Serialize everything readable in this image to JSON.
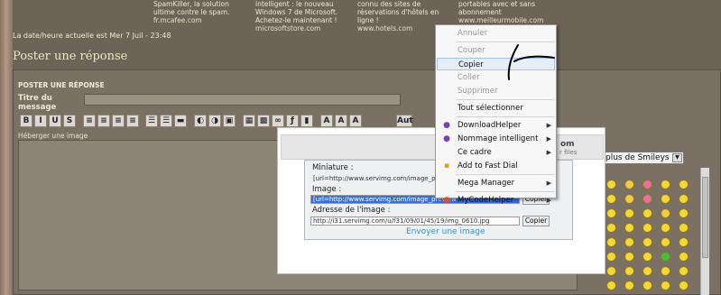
{
  "ads": [
    {
      "text": "SpamKiller, la solution ultime contre le spam.",
      "url": "fr.mcafee.com"
    },
    {
      "text": "intelligent : le nouveau Windows 7 de Microsoft. Achetez-le maintenant !",
      "url": "microsoftstore.com"
    },
    {
      "text": "connu des sites de réservations d'hôtels en ligne !",
      "url": "www.hotels.com"
    },
    {
      "text": "portables avec et sans abonnement",
      "url": "www.meilleurmobile.com"
    }
  ],
  "date_line": "La date/heure actuelle est Mer 7 Juil - 23:48",
  "page_title": "Poster une réponse",
  "form": {
    "heading": "POSTER UNE RÉPONSE",
    "title_label": "Titre du message",
    "host_label": "Héberger une image",
    "toolbar": [
      "B",
      "I",
      "U",
      "S",
      "≡",
      "≡",
      "≡",
      "≡",
      "☰",
      "☰",
      "▬",
      "◐",
      "◑",
      "▣",
      "▦",
      "▩",
      "∞",
      "ƒ",
      "▮",
      "A",
      "A",
      "A",
      "Aut"
    ]
  },
  "smileys": {
    "select_label": "plus de Smileys",
    "colors": [
      "#f6d63a",
      "#f3c84a",
      "#e96f9c",
      "#f6d63a",
      "#f6d63a",
      "#f6d63a",
      "#f3c84a",
      "#e96f9c",
      "#f6d63a",
      "#f6d63a",
      "#f6d63a",
      "#f6d63a",
      "#f6d63a",
      "#f3c84a",
      "#f6d63a",
      "#f6d63a",
      "#f6d63a",
      "#f6d63a",
      "#f6d63a",
      "#f6d63a",
      "#f6d63a",
      "#f6d63a",
      "#f6d63a",
      "#f6d63a",
      "#f6d63a",
      "#f6d63a",
      "#f6d63a",
      "#f6d63a",
      "#3fbf3f",
      "#f6d63a",
      "#f6d63a",
      "#f6d63a",
      "#f6d63a",
      "#f6d63a",
      "#f6d63a",
      "#f6d63a",
      "#f6d63a",
      "#f6d63a",
      "#f6d63a",
      "#f6d63a"
    ]
  },
  "servimg": {
    "brand": "om",
    "brand_sub": "r files",
    "miniature_label": "Miniature :",
    "miniature_value": "[url=http://www.servimg.com/image_previ",
    "image_label": "Image :",
    "image_value": "[url=http://www.servimg.com/image_preview",
    "address_label": "Adresse de l'image :",
    "address_value": "http://i31.servimg.com/u/f31/09/01/45/19/img_0610.jpg",
    "copy_label": "Copier",
    "send_label": "Envoyer une image"
  },
  "context_menu": [
    {
      "label": "Annuler",
      "enabled": false
    },
    {
      "sep": true
    },
    {
      "label": "Couper",
      "enabled": false
    },
    {
      "label": "Copier",
      "enabled": true,
      "highlighted": true
    },
    {
      "label": "Coller",
      "enabled": false
    },
    {
      "label": "Supprimer",
      "enabled": false
    },
    {
      "sep": true
    },
    {
      "label": "Tout sélectionner",
      "enabled": true
    },
    {
      "sep": true
    },
    {
      "label": "DownloadHelper",
      "enabled": true,
      "submenu": true,
      "icon": "downloadhelper-icon"
    },
    {
      "label": "Nommage intelligent",
      "enabled": true,
      "submenu": true,
      "icon": "downloadhelper-icon"
    },
    {
      "label": "Ce cadre",
      "enabled": true,
      "submenu": true
    },
    {
      "label": "Add to Fast Dial",
      "enabled": true,
      "icon": "fastdial-icon"
    },
    {
      "sep": true
    },
    {
      "label": "Mega Manager",
      "enabled": true,
      "submenu": true
    },
    {
      "sep": true
    },
    {
      "label": "MyCodeHelper",
      "enabled": true,
      "submenu": true,
      "icon": "mycodehelper-icon"
    }
  ],
  "colors": {
    "bg": "#6d6357",
    "title": "#f2e7bf",
    "link": "#3b8fc9",
    "selection": "#3a6fd8"
  }
}
